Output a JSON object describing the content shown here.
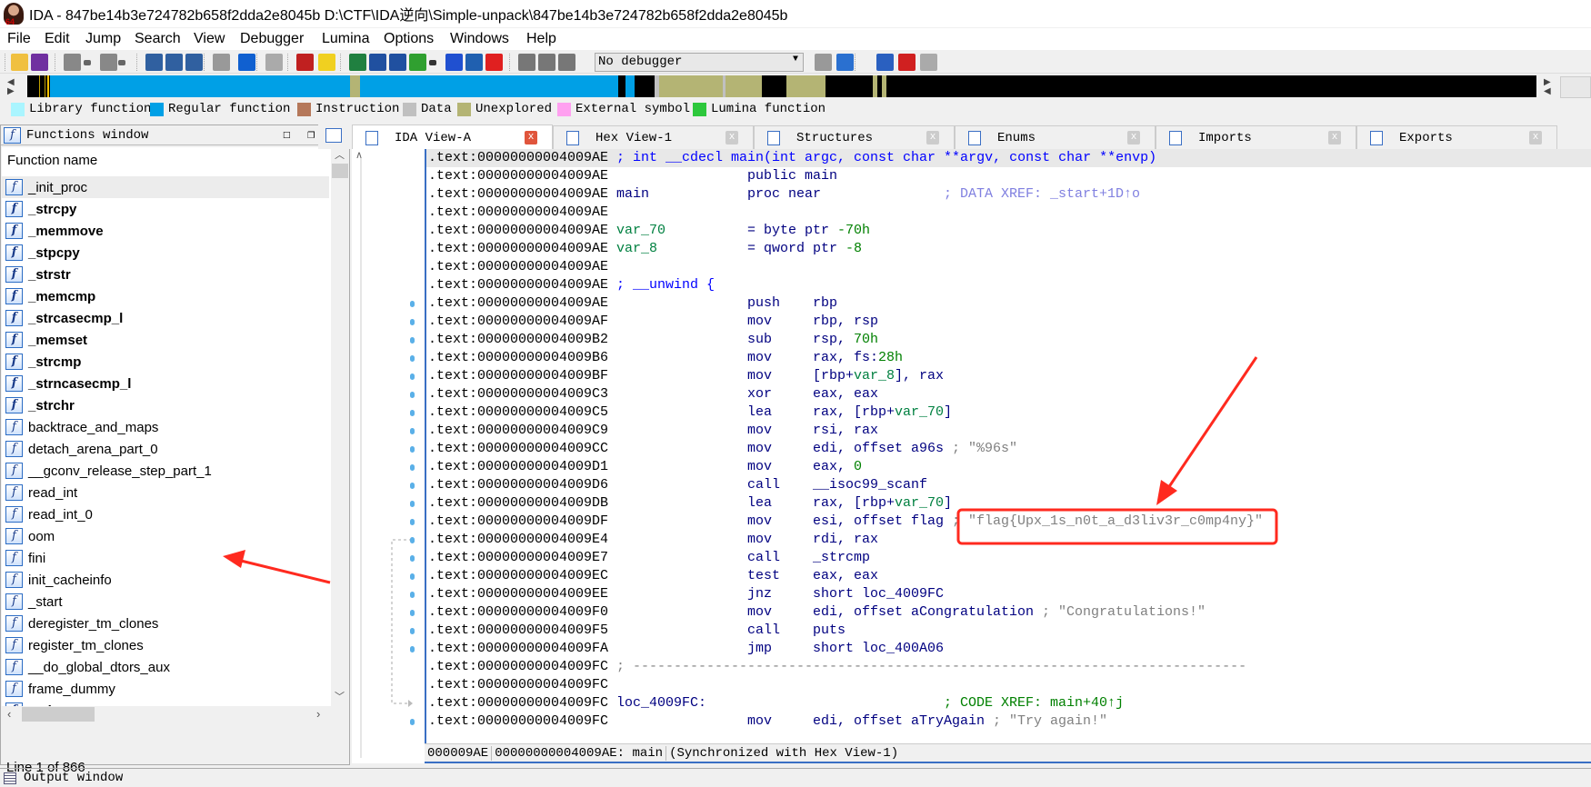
{
  "window": {
    "title": "IDA - 847be14b3e724782b658f2dda2e8045b D:\\CTF\\IDA逆向\\Simple-unpack\\847be14b3e724782b658f2dda2e8045b",
    "icon_badge": "64"
  },
  "menu": [
    "File",
    "Edit",
    "Jump",
    "Search",
    "View",
    "Debugger",
    "Lumina",
    "Options",
    "Windows",
    "Help"
  ],
  "toolbar": {
    "icons": [
      "open-icon",
      "save-icon",
      "back-icon",
      "back-dropdown-icon",
      "forward-icon",
      "forward-dropdown-icon",
      "search-binary-icon",
      "search-text-icon",
      "search-immediate-icon",
      "jump-icon",
      "down-arrow-icon",
      "lock-icon",
      "error-icon",
      "bulb-icon",
      "create-code-icon",
      "create-data-icon",
      "create-string-icon",
      "create-struct-icon",
      "create-struct-dropdown-icon",
      "enum-icon",
      "rename-icon",
      "delete-icon",
      "run-icon",
      "pause-icon",
      "stop-icon"
    ],
    "debugger_select": "No debugger",
    "right_icons": [
      "step-into-icon",
      "step-over-icon",
      "breakpoint-list-icon",
      "add-breakpoint-icon",
      "delete-breakpoint-icon"
    ]
  },
  "legend": [
    {
      "label": "Library function",
      "color": "#aaf5ff"
    },
    {
      "label": "Regular function",
      "color": "#00a0e6"
    },
    {
      "label": "Instruction",
      "color": "#b5785a"
    },
    {
      "label": "Data",
      "color": "#c0c0c0"
    },
    {
      "label": "Unexplored",
      "color": "#b4b474"
    },
    {
      "label": "External symbol",
      "color": "#ffa0f0"
    },
    {
      "label": "Lumina function",
      "color": "#2dc83c"
    }
  ],
  "functions_window": {
    "title": "Functions window",
    "column": "Function name",
    "items": [
      {
        "name": "_init_proc",
        "bold": false
      },
      {
        "name": "_strcpy",
        "bold": true
      },
      {
        "name": "_memmove",
        "bold": true
      },
      {
        "name": "_stpcpy",
        "bold": true
      },
      {
        "name": "_strstr",
        "bold": true
      },
      {
        "name": "_memcmp",
        "bold": true
      },
      {
        "name": "_strcasecmp_l",
        "bold": true
      },
      {
        "name": "_memset",
        "bold": true
      },
      {
        "name": "_strcmp",
        "bold": true
      },
      {
        "name": "_strncasecmp_l",
        "bold": true
      },
      {
        "name": "_strchr",
        "bold": true
      },
      {
        "name": "backtrace_and_maps",
        "bold": false
      },
      {
        "name": "detach_arena_part_0",
        "bold": false
      },
      {
        "name": "__gconv_release_step_part_1",
        "bold": false
      },
      {
        "name": "read_int",
        "bold": false
      },
      {
        "name": "read_int_0",
        "bold": false
      },
      {
        "name": "oom",
        "bold": false
      },
      {
        "name": "fini",
        "bold": false
      },
      {
        "name": "init_cacheinfo",
        "bold": false
      },
      {
        "name": "_start",
        "bold": false
      },
      {
        "name": "deregister_tm_clones",
        "bold": false
      },
      {
        "name": "register_tm_clones",
        "bold": false
      },
      {
        "name": "__do_global_dtors_aux",
        "bold": false
      },
      {
        "name": "frame_dummy",
        "bold": false
      },
      {
        "name": "main",
        "bold": true
      }
    ],
    "status": "Line 1 of 866"
  },
  "tabs": [
    {
      "label": "IDA View-A",
      "active": true
    },
    {
      "label": "Hex View-1"
    },
    {
      "label": "Structures"
    },
    {
      "label": "Enums"
    },
    {
      "label": "Imports"
    },
    {
      "label": "Exports"
    }
  ],
  "code": {
    "lines": [
      {
        "addr": ".text:00000000004009AE",
        "label": [
          {
            "t": "; int __cdecl main(int argc, const char **argv, const char **envp)",
            "k": "hdr"
          }
        ]
      },
      {
        "addr": ".text:00000000004009AE",
        "ops": [
          {
            "t": "public main",
            "k": "op"
          }
        ]
      },
      {
        "addr": ".text:00000000004009AE",
        "label": [
          {
            "t": "main",
            "k": "nm"
          }
        ],
        "ops": [
          {
            "t": "proc near",
            "k": "op"
          }
        ],
        "xref": {
          "t": "; DATA XREF: _start+1D↑o",
          "k": "dx"
        }
      },
      {
        "addr": ".text:00000000004009AE"
      },
      {
        "addr": ".text:00000000004009AE",
        "label": [
          {
            "t": "var_70",
            "k": "var"
          }
        ],
        "ops": [
          {
            "t": "= byte ptr ",
            "k": "op"
          },
          {
            "t": "-70h",
            "k": "num"
          }
        ]
      },
      {
        "addr": ".text:00000000004009AE",
        "label": [
          {
            "t": "var_8",
            "k": "var"
          }
        ],
        "ops": [
          {
            "t": "= qword ptr ",
            "k": "op"
          },
          {
            "t": "-8",
            "k": "num"
          }
        ]
      },
      {
        "addr": ".text:00000000004009AE"
      },
      {
        "addr": ".text:00000000004009AE",
        "label": [
          {
            "t": "; __unwind {",
            "k": "hdr"
          }
        ]
      },
      {
        "addr": ".text:00000000004009AE",
        "mnem": "push",
        "ops": [
          {
            "t": "rbp",
            "k": "op"
          }
        ]
      },
      {
        "addr": ".text:00000000004009AF",
        "mnem": "mov",
        "ops": [
          {
            "t": "rbp, rsp",
            "k": "op"
          }
        ]
      },
      {
        "addr": ".text:00000000004009B2",
        "mnem": "sub",
        "ops": [
          {
            "t": "rsp, ",
            "k": "op"
          },
          {
            "t": "70h",
            "k": "num"
          }
        ]
      },
      {
        "addr": ".text:00000000004009B6",
        "mnem": "mov",
        "ops": [
          {
            "t": "rax, fs:",
            "k": "op"
          },
          {
            "t": "28h",
            "k": "num"
          }
        ]
      },
      {
        "addr": ".text:00000000004009BF",
        "mnem": "mov",
        "ops": [
          {
            "t": "[rbp+",
            "k": "op"
          },
          {
            "t": "var_8",
            "k": "var"
          },
          {
            "t": "], rax",
            "k": "op"
          }
        ]
      },
      {
        "addr": ".text:00000000004009C3",
        "mnem": "xor",
        "ops": [
          {
            "t": "eax, eax",
            "k": "op"
          }
        ]
      },
      {
        "addr": ".text:00000000004009C5",
        "mnem": "lea",
        "ops": [
          {
            "t": "rax, [rbp+",
            "k": "op"
          },
          {
            "t": "var_70",
            "k": "var"
          },
          {
            "t": "]",
            "k": "op"
          }
        ]
      },
      {
        "addr": ".text:00000000004009C9",
        "mnem": "mov",
        "ops": [
          {
            "t": "rsi, rax",
            "k": "op"
          }
        ]
      },
      {
        "addr": ".text:00000000004009CC",
        "mnem": "mov",
        "ops": [
          {
            "t": "edi, offset a96s",
            "k": "op"
          },
          {
            "t": " ; \"%96s\"",
            "k": "str"
          }
        ]
      },
      {
        "addr": ".text:00000000004009D1",
        "mnem": "mov",
        "ops": [
          {
            "t": "eax, ",
            "k": "op"
          },
          {
            "t": "0",
            "k": "num"
          }
        ]
      },
      {
        "addr": ".text:00000000004009D6",
        "mnem": "call",
        "ops": [
          {
            "t": "__isoc99_scanf",
            "k": "op"
          }
        ]
      },
      {
        "addr": ".text:00000000004009DB",
        "mnem": "lea",
        "ops": [
          {
            "t": "rax, [rbp+",
            "k": "op"
          },
          {
            "t": "var_70",
            "k": "var"
          },
          {
            "t": "]",
            "k": "op"
          }
        ]
      },
      {
        "addr": ".text:00000000004009DF",
        "mnem": "mov",
        "ops": [
          {
            "t": "esi, offset flag",
            "k": "op"
          },
          {
            "t": " ; \"flag{Upx_1s_n0t_a_d3liv3r_c0mp4ny}\"",
            "k": "str"
          }
        ]
      },
      {
        "addr": ".text:00000000004009E4",
        "mnem": "mov",
        "ops": [
          {
            "t": "rdi, rax",
            "k": "op"
          }
        ]
      },
      {
        "addr": ".text:00000000004009E7",
        "mnem": "call",
        "ops": [
          {
            "t": "_strcmp",
            "k": "op"
          }
        ]
      },
      {
        "addr": ".text:00000000004009EC",
        "mnem": "test",
        "ops": [
          {
            "t": "eax, eax",
            "k": "op"
          }
        ]
      },
      {
        "addr": ".text:00000000004009EE",
        "mnem": "jnz",
        "ops": [
          {
            "t": "short loc_4009FC",
            "k": "op"
          }
        ]
      },
      {
        "addr": ".text:00000000004009F0",
        "mnem": "mov",
        "ops": [
          {
            "t": "edi, offset aCongratulation",
            "k": "op"
          },
          {
            "t": " ; \"Congratulations!\"",
            "k": "str"
          }
        ]
      },
      {
        "addr": ".text:00000000004009F5",
        "mnem": "call",
        "ops": [
          {
            "t": "puts",
            "k": "op"
          }
        ]
      },
      {
        "addr": ".text:00000000004009FA",
        "mnem": "jmp",
        "ops": [
          {
            "t": "short loc_400A06",
            "k": "op"
          }
        ]
      },
      {
        "addr": ".text:00000000004009FC",
        "label": [
          {
            "t": "; ---------------------------------------------------------------------------",
            "k": "cmt"
          }
        ]
      },
      {
        "addr": ".text:00000000004009FC"
      },
      {
        "addr": ".text:00000000004009FC",
        "label": [
          {
            "t": "loc_4009FC:",
            "k": "nm"
          }
        ],
        "xref": {
          "t": "; CODE XREF: main+40↑j",
          "k": "cx"
        }
      },
      {
        "addr": ".text:00000000004009FC",
        "mnem": "mov",
        "ops": [
          {
            "t": "edi, offset aTryAgain",
            "k": "op"
          },
          {
            "t": " ; \"Try again!\"",
            "k": "str"
          }
        ]
      }
    ]
  },
  "status_bar": [
    "000009AE",
    "00000000004009AE: main",
    "(Synchronized with Hex View-1)"
  ],
  "output_window": {
    "title": "Output window"
  },
  "annotation_color": "#ff2a1f"
}
